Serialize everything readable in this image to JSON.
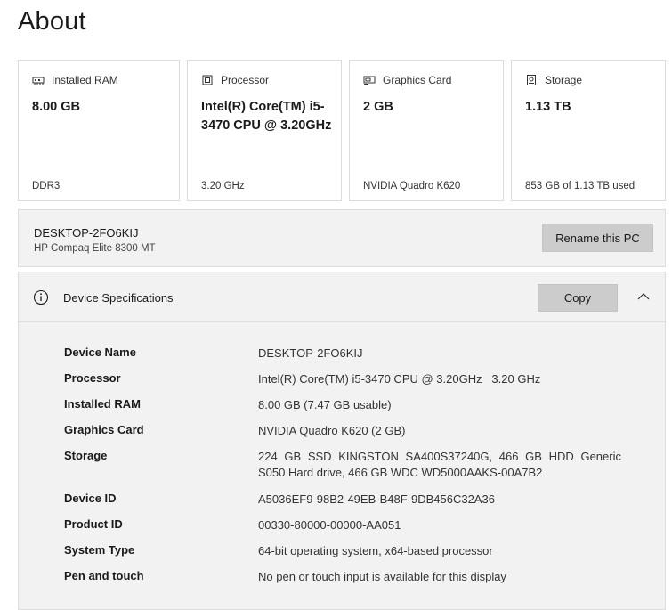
{
  "page": {
    "title": "About"
  },
  "cards": [
    {
      "label": "Installed RAM",
      "icon": "ram-icon",
      "value": "8.00 GB",
      "sub": "DDR3"
    },
    {
      "label": "Processor",
      "icon": "processor-icon",
      "value": "Intel(R) Core(TM) i5-3470 CPU @ 3.20GHz",
      "sub": "3.20 GHz"
    },
    {
      "label": "Graphics Card",
      "icon": "graphics-card-icon",
      "value": "2 GB",
      "sub": "NVIDIA Quadro K620"
    },
    {
      "label": "Storage",
      "icon": "storage-icon",
      "value": "1.13 TB",
      "sub": "853 GB of 1.13 TB used"
    }
  ],
  "pc": {
    "name": "DESKTOP-2FO6KIJ",
    "model": "HP Compaq Elite 8300 MT",
    "rename_label": "Rename this PC"
  },
  "specs": {
    "title": "Device Specifications",
    "copy_label": "Copy",
    "rows": [
      {
        "label": "Device Name",
        "value": "DESKTOP-2FO6KIJ"
      },
      {
        "label": "Processor",
        "value": "Intel(R) Core(TM) i5-3470 CPU @ 3.20GHz   3.20 GHz"
      },
      {
        "label": "Installed RAM",
        "value": "8.00 GB (7.47 GB usable)"
      },
      {
        "label": "Graphics Card",
        "value": "NVIDIA Quadro K620 (2 GB)"
      },
      {
        "label": "Storage",
        "value": "224 GB SSD KINGSTON SA400S37240G, 466 GB HDD Generic S050 Hard drive, 466 GB WDC WD5000AAKS-00A7B2"
      },
      {
        "label": "Device ID",
        "value": "A5036EF9-98B2-49EB-B48F-9DB456C32A36"
      },
      {
        "label": "Product ID",
        "value": "00330-80000-00000-AA051"
      },
      {
        "label": "System Type",
        "value": "64-bit operating system, x64-based processor"
      },
      {
        "label": "Pen and touch",
        "value": "No pen or touch input is available for this display"
      }
    ]
  }
}
